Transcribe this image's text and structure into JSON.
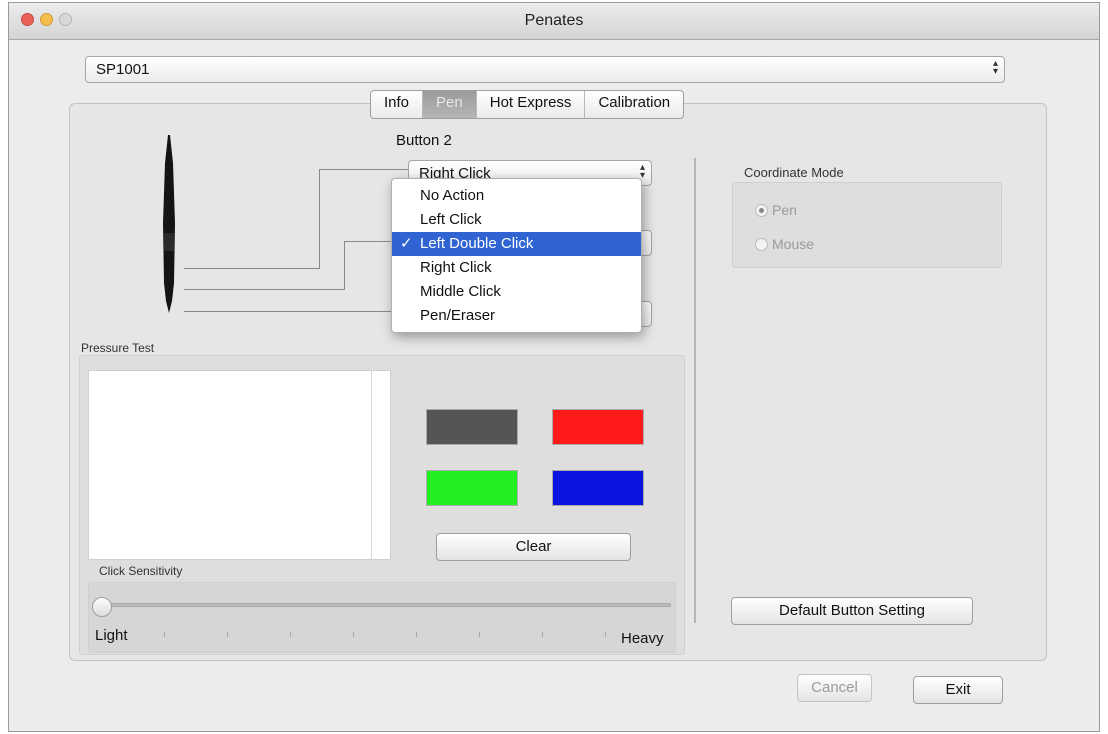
{
  "window": {
    "title": "Penates"
  },
  "device_select": {
    "value": "SP1001"
  },
  "tabs": [
    {
      "label": "Info"
    },
    {
      "label": "Pen"
    },
    {
      "label": "Hot Express"
    },
    {
      "label": "Calibration"
    }
  ],
  "pen": {
    "button_label": "Button 2",
    "dropdown_value": "Right Click",
    "menu": [
      {
        "label": "No Action"
      },
      {
        "label": "Left Click"
      },
      {
        "label": "Left Double Click",
        "check": "✓"
      },
      {
        "label": "Right Click"
      },
      {
        "label": "Middle Click"
      },
      {
        "label": "Pen/Eraser"
      }
    ]
  },
  "pressure": {
    "title": "Pressure Test",
    "colors": [
      "#555555",
      "#ff1a1a",
      "#22ee22",
      "#0a14e0"
    ],
    "clear_label": "Clear"
  },
  "sensitivity": {
    "title": "Click Sensitivity",
    "min_label": "Light",
    "max_label": "Heavy",
    "value": 0
  },
  "coordinate": {
    "title": "Coordinate Mode",
    "options": [
      {
        "label": "Pen",
        "selected": true
      },
      {
        "label": "Mouse",
        "selected": false
      }
    ]
  },
  "buttons": {
    "default": "Default Button Setting",
    "cancel": "Cancel",
    "exit": "Exit"
  }
}
